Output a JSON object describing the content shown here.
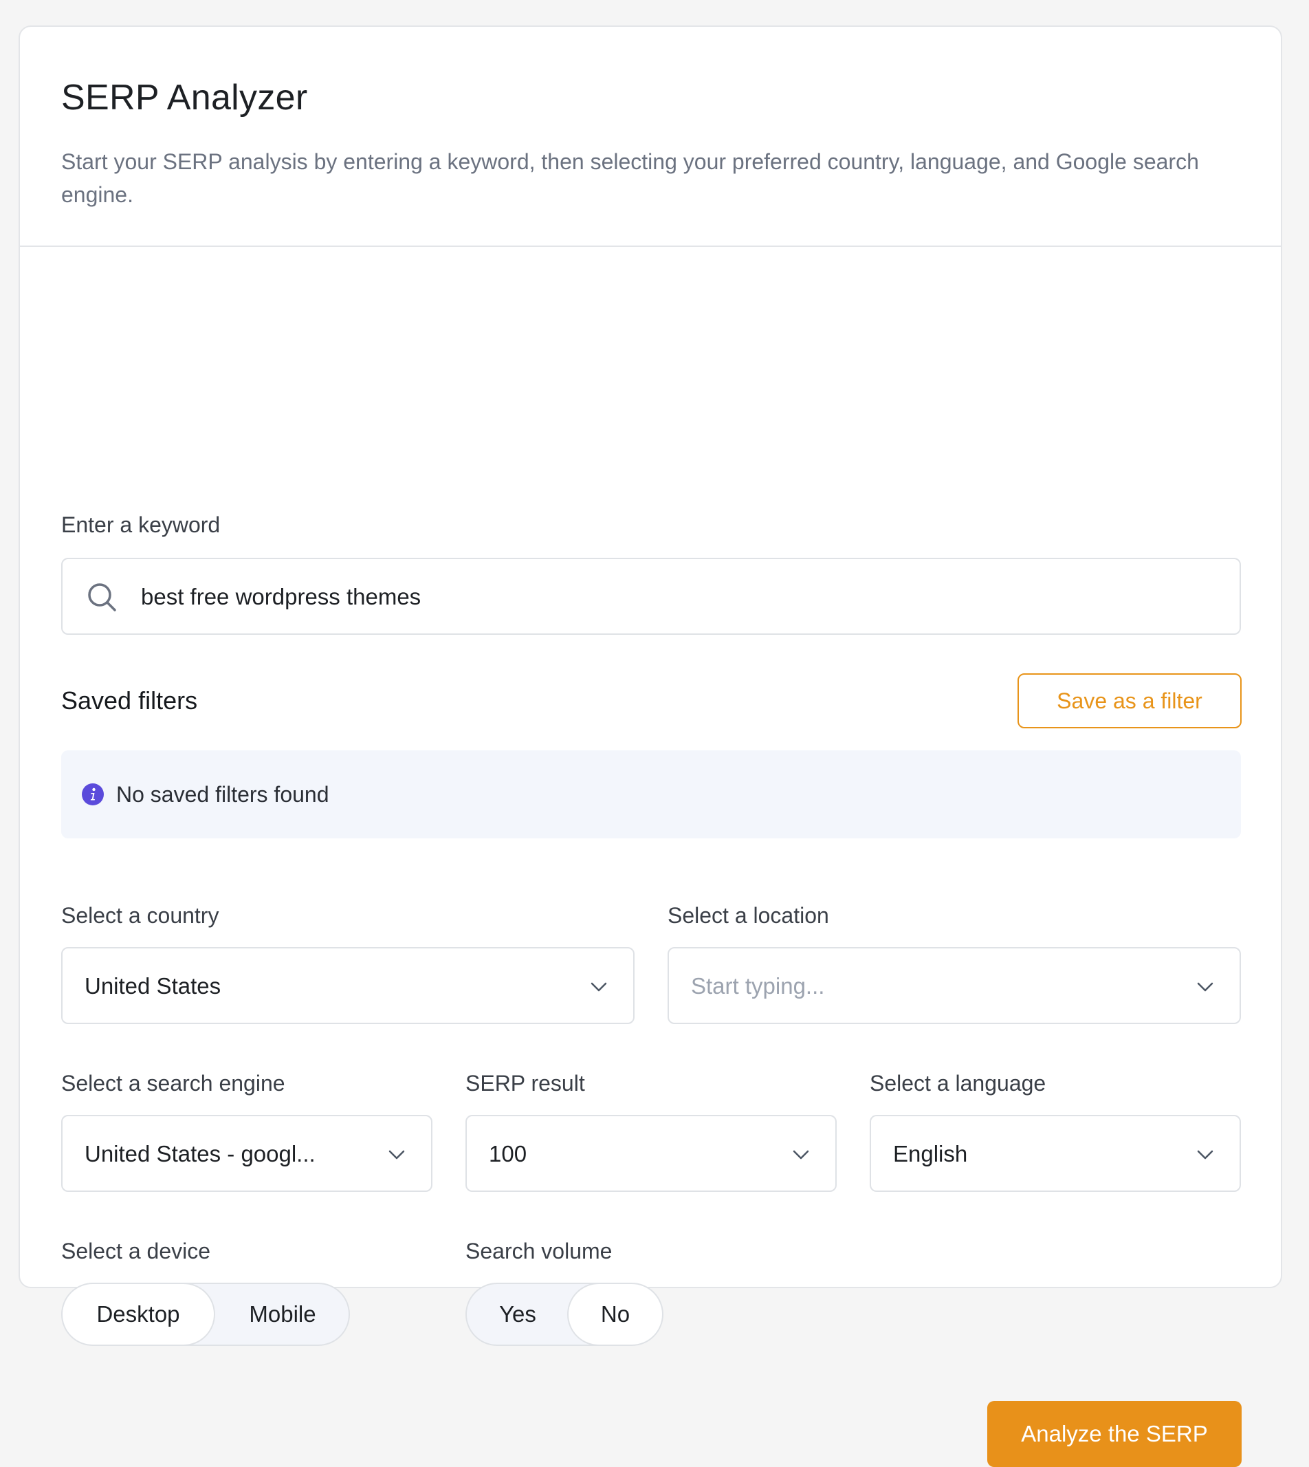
{
  "header": {
    "title": "SERP Analyzer",
    "subtitle": "Start your SERP analysis by entering a keyword, then selecting your preferred country, language, and Google search engine."
  },
  "keyword": {
    "label": "Enter a keyword",
    "value": "best free wordpress themes",
    "icon": "search-icon"
  },
  "saved_filters": {
    "title": "Saved filters",
    "save_button": "Save as a filter",
    "empty_message": "No saved filters found",
    "empty_icon": "info-icon"
  },
  "country": {
    "label": "Select a country",
    "value": "United States"
  },
  "location": {
    "label": "Select a location",
    "placeholder": "Start typing..."
  },
  "search_engine": {
    "label": "Select a search engine",
    "value": "United States - googl..."
  },
  "serp_result": {
    "label": "SERP result",
    "value": "100"
  },
  "language": {
    "label": "Select a language",
    "value": "English"
  },
  "device": {
    "label": "Select a device",
    "options": [
      "Desktop",
      "Mobile"
    ],
    "selected": "Desktop"
  },
  "search_volume": {
    "label": "Search volume",
    "options": [
      "Yes",
      "No"
    ],
    "selected": "No"
  },
  "actions": {
    "analyze_button": "Analyze the SERP"
  },
  "colors": {
    "accent": "#e8911a",
    "info": "#5b4bdb",
    "notice_bg": "#f3f6fc"
  }
}
